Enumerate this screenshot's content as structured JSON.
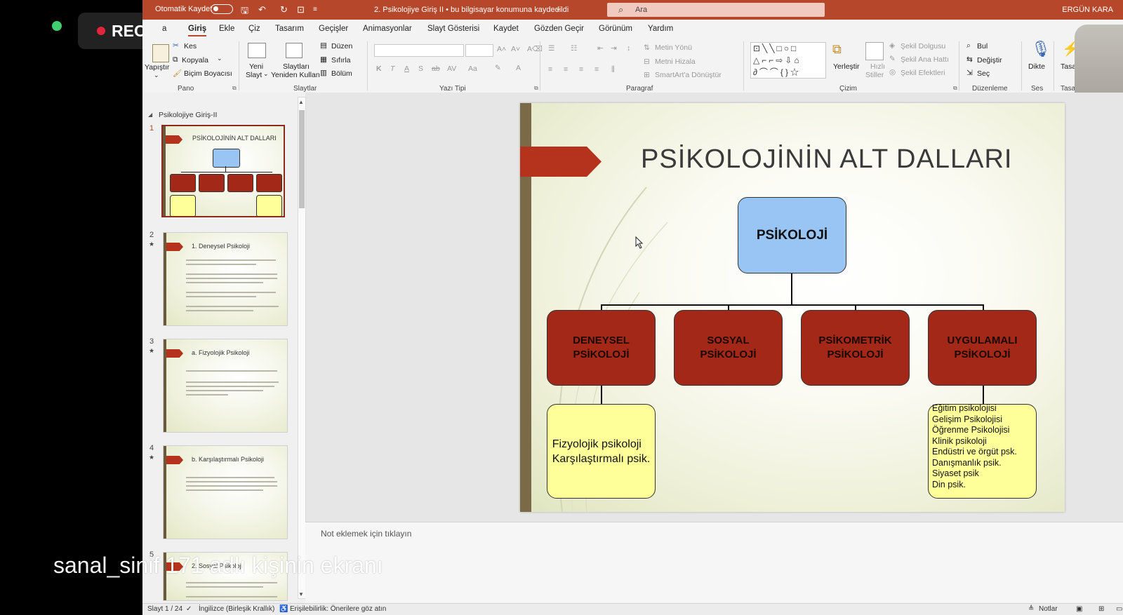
{
  "titlebar": {
    "autosave_label": "Otomatik Kaydet",
    "document_title": "2. Psikolojiye Giriş II  •  bu bilgisayar konumuna kaydedildi",
    "search_placeholder": "Ara",
    "user_name": "ERGÜN KARA"
  },
  "rec": {
    "label": "REC"
  },
  "tabs": [
    "a",
    "Giriş",
    "Ekle",
    "Çiz",
    "Tasarım",
    "Geçişler",
    "Animasyonlar",
    "Slayt Gösterisi",
    "Kaydet",
    "Gözden Geçir",
    "Görünüm",
    "Yardım"
  ],
  "ribbon": {
    "pano": {
      "label": "Pano",
      "paste": "Yapıştır",
      "cut": "Kes",
      "copy": "Kopyala",
      "format_painter": "Biçim Boyacısı"
    },
    "slaytlar": {
      "label": "Slaytlar",
      "new_slide_1": "Yeni",
      "new_slide_2": "Slayt",
      "reuse_1": "Slaytları",
      "reuse_2": "Yeniden Kullan",
      "layout": "Düzen",
      "reset": "Sıfırla",
      "section": "Bölüm"
    },
    "yazitipi": {
      "label": "Yazı Tipi",
      "bold": "K",
      "italic": "T",
      "underline": "A",
      "shadow": "S",
      "strike": "ab",
      "spacing": "AV",
      "case": "Aa"
    },
    "paragraf": {
      "label": "Paragraf",
      "text_direction": "Metin Yönü",
      "align_text": "Metni Hizala",
      "smartart": "SmartArt'a Dönüştür"
    },
    "cizim": {
      "label": "Çizim",
      "arrange": "Yerleştir",
      "quick_styles_1": "Hızlı",
      "quick_styles_2": "Stiller",
      "shape_fill": "Şekil Dolgusu",
      "shape_outline": "Şekil Ana Hattı",
      "shape_effects": "Şekil Efektleri"
    },
    "duzenleme": {
      "label": "Düzenleme",
      "find": "Bul",
      "replace": "Değiştir",
      "select": "Seç"
    },
    "ses": {
      "label": "Ses",
      "dictate": "Dikte"
    },
    "tasarim": {
      "label": "Tasa",
      "designer": "Tasar"
    }
  },
  "thumbnails": {
    "section": "Psikolojiye Giriş-II",
    "slides": [
      {
        "num": "1",
        "title": "PSİKOLOJİNİN  ALT DALLARI"
      },
      {
        "num": "2",
        "title": "1. Deneysel Psikoloji"
      },
      {
        "num": "3",
        "title": "a. Fizyolojik Psikoloji"
      },
      {
        "num": "4",
        "title": "b. Karşılaştırmalı Psikoloji"
      },
      {
        "num": "5",
        "title": "2. Sosyal Psikoloji"
      }
    ]
  },
  "slide": {
    "title": "PSİKOLOJİNİN  ALT DALLARI",
    "root": "PSİKOLOJİ",
    "branches": [
      {
        "line1": "DENEYSEL",
        "line2": "PSİKOLOJİ"
      },
      {
        "line1": "SOSYAL",
        "line2": "PSİKOLOJİ"
      },
      {
        "line1": "PSİKOMETRİK",
        "line2": "PSİKOLOJİ"
      },
      {
        "line1": "UYGULAMALI",
        "line2": "PSİKOLOJİ"
      }
    ],
    "left_note": [
      "Fizyolojik psikoloji",
      "Karşılaştırmalı psik."
    ],
    "right_note": [
      "Eğitim psikolojisi",
      "Gelişim Psikolojisi",
      "Öğrenme Psikolojisi",
      "Klinik psikoloji",
      "Endüstri ve örgüt psk.",
      "Danışmanlık psik.",
      "Siyaset psik",
      "Din psik."
    ]
  },
  "notes": {
    "placeholder": "Not eklemek için tıklayın"
  },
  "status": {
    "slide_counter": "Slayt 1 / 24",
    "language": "İngilizce (Birleşik Krallık)",
    "accessibility": "Erişilebilirlik: Önerilere göz atın",
    "notes_button": "Notlar"
  },
  "overlay": {
    "share_text": "sanal_sinif 171 adlı kişinin ekranı"
  },
  "colors": {
    "accent": "#b7472a",
    "branch_red": "#a42818",
    "root_blue": "#99c5f5",
    "note_yellow": "#ffff99"
  }
}
